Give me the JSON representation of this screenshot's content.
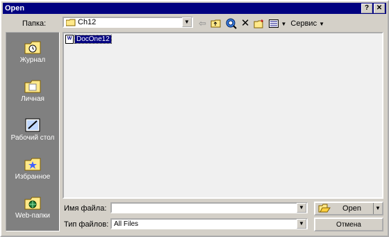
{
  "window": {
    "title": "Open",
    "help_label": "?",
    "close_label": "✕"
  },
  "lookin": {
    "label": "Папка:",
    "value": "Ch12"
  },
  "toolbar": {
    "back_icon": "back-arrow-icon",
    "up_icon": "up-folder-icon",
    "web_icon": "search-web-icon",
    "delete_icon": "delete-icon",
    "new_folder_icon": "new-folder-icon",
    "views_icon": "views-icon",
    "tools_label": "Сервис"
  },
  "places": [
    {
      "label": "Журнал",
      "icon": "history-folder-icon"
    },
    {
      "label": "Личная",
      "icon": "my-documents-folder-icon"
    },
    {
      "label": "Рабочий стол",
      "icon": "desktop-icon"
    },
    {
      "label": "Избранное",
      "icon": "favorites-folder-icon"
    },
    {
      "label": "Web-папки",
      "icon": "web-folders-icon"
    }
  ],
  "files": [
    {
      "name": "DocOne12",
      "icon": "word-document-icon",
      "selected": true
    }
  ],
  "filename": {
    "label": "Имя файла:",
    "value": ""
  },
  "filetype": {
    "label": "Тип файлов:",
    "value": "All Files"
  },
  "buttons": {
    "open_label": "Open",
    "cancel_label": "Отмена"
  }
}
